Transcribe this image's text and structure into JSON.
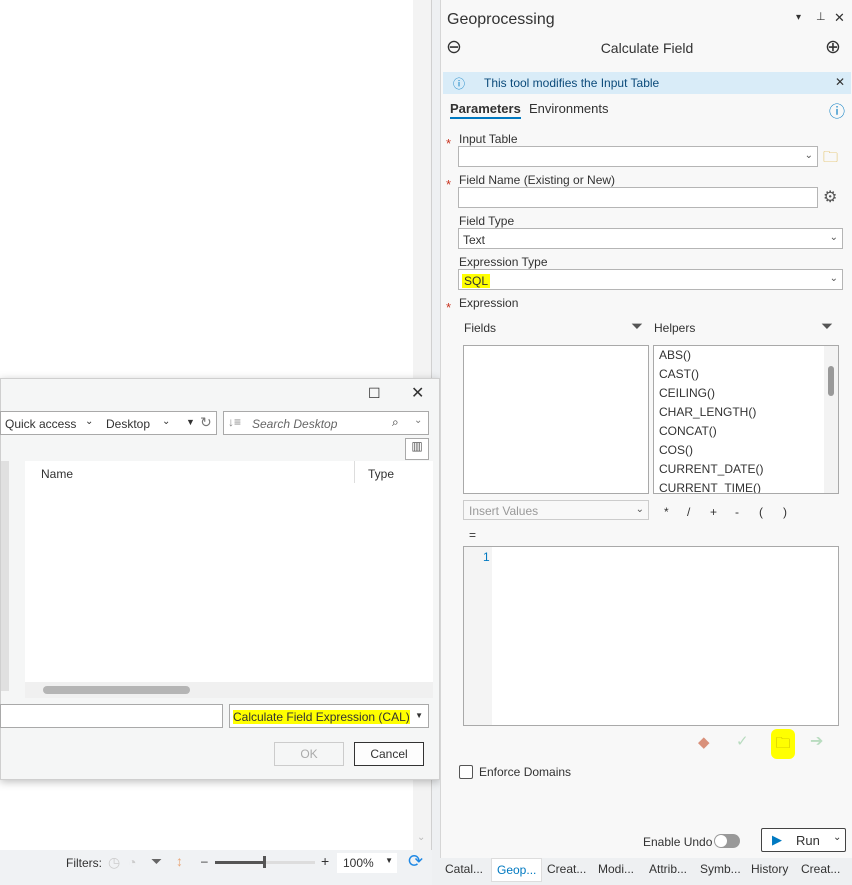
{
  "dialog": {
    "breadcrumb": [
      "Quick access",
      "Desktop"
    ],
    "search_placeholder": "Search Desktop",
    "columns": [
      "Name",
      "Type"
    ],
    "filename": "",
    "filetype": "Calculate Field Expression (CAL)",
    "ok": "OK",
    "cancel": "Cancel"
  },
  "statusbar": {
    "filters_label": "Filters:",
    "zoom": "100%",
    "zoom_level_percent": 100
  },
  "pane": {
    "title": "Geoprocessing",
    "tool": "Calculate Field",
    "info": "This tool modifies the Input Table",
    "tabs": [
      "Parameters",
      "Environments"
    ],
    "input_table_label": "Input Table",
    "input_table_value": "",
    "field_name_label": "Field Name (Existing or New)",
    "field_name_value": "",
    "field_type_label": "Field Type",
    "field_type_value": "Text",
    "expr_type_label": "Expression Type",
    "expr_type_value": "SQL",
    "expression_label": "Expression",
    "fields_label": "Fields",
    "helpers_label": "Helpers",
    "helpers": [
      "ABS()",
      "CAST()",
      "CEILING()",
      "CHAR_LENGTH()",
      "CONCAT()",
      "COS()",
      "CURRENT_DATE()",
      "CURRENT_TIME()"
    ],
    "insert_values": "Insert Values",
    "operators": [
      "*",
      "/",
      "+",
      "-",
      "(",
      ")"
    ],
    "equals": "=",
    "line_number": "1",
    "enforce_domains": "Enforce Domains",
    "enable_undo": "Enable Undo",
    "run": "Run"
  },
  "bottom_tabs": [
    "Catal...",
    "Geop...",
    "Creat...",
    "Modi...",
    "Attrib...",
    "Symb...",
    "History",
    "Creat..."
  ],
  "colors": {
    "accent": "#0079c1",
    "highlight": "#ffff00",
    "info_bg": "#d9ecf8",
    "required": "#c8321e"
  }
}
